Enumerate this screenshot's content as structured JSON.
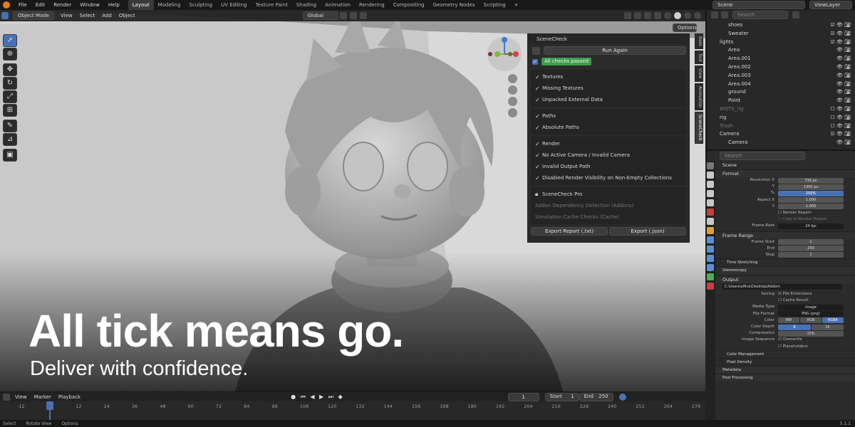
{
  "topbar": {
    "menus": [
      "File",
      "Edit",
      "Render",
      "Window",
      "Help"
    ],
    "workspaces": [
      "Layout",
      "Modeling",
      "Sculpting",
      "UV Editing",
      "Texture Paint",
      "Shading",
      "Animation",
      "Rendering",
      "Compositing",
      "Geometry Nodes",
      "Scripting"
    ],
    "add_tab": "+",
    "scene_label": "Scene",
    "view_layer_label": "ViewLayer"
  },
  "viewport_header": {
    "mode": "Object Mode",
    "menus": [
      "View",
      "Select",
      "Add",
      "Object"
    ],
    "transform": "Global",
    "options": "Options"
  },
  "scenecheck": {
    "title": "SceneCheck",
    "run_again": "Run Again",
    "status": "All checks passed",
    "groups": [
      {
        "items": [
          "Textures",
          "Missing Textures",
          "Unpacked External Data"
        ]
      },
      {
        "items": [
          "Paths",
          "Absolute Paths"
        ]
      },
      {
        "items": [
          "Render",
          "No Active Camera / Invalid Camera",
          "Invalid Output Path",
          "Disabled Render Visibility on Non-Empty Collections"
        ]
      }
    ],
    "pro_label": "SceneCheck Pro",
    "pro_items": [
      "Addon Dependency Detection (Addons)",
      "Simulation Cache Checks (Cache)"
    ],
    "export_txt": "Export Report (.txt)",
    "export_json": "Export (.json)"
  },
  "side_tabs": [
    "Item",
    "Tool",
    "View",
    "Animation",
    "SceneCheck"
  ],
  "overlay": {
    "headline": "All tick means go.",
    "subline": "Deliver with confidence."
  },
  "outliner": {
    "search_placeholder": "Search",
    "rows": [
      "shoes",
      "Sweater",
      "lights",
      "Area",
      "Area.001",
      "Area.002",
      "Area.003",
      "Area.004",
      "ground",
      "Point",
      "WGTS_rig",
      "rig",
      "Trash",
      "Camera",
      "Camera"
    ]
  },
  "properties": {
    "search_placeholder": "Search",
    "breadcrumb": "Scene",
    "format_section": "Format",
    "resolution_x_label": "Resolution X",
    "resolution_x": "736 px",
    "y_label": "Y",
    "resolution_y": "1305 px",
    "pct_label": "%",
    "resolution_pct": "200%",
    "aspect_x_label": "Aspect X",
    "aspect_x": "1.000",
    "aspect_y": "1.000",
    "render_region": "Render Region",
    "crop_region": "Crop to Render Region",
    "frame_rate_label": "Frame Rate",
    "frame_rate": "24 fps",
    "frame_range_section": "Frame Range",
    "frame_start_label": "Frame Start",
    "frame_start": "1",
    "end_label": "End",
    "frame_end": "250",
    "step_label": "Step",
    "frame_step": "1",
    "time_stretching": "Time Stretching",
    "stereoscopy": "Stereoscopy",
    "output_section": "Output",
    "output_path": "C:\\Users\\office\\Desktop\\Addon\\",
    "saving_label": "Saving",
    "file_extensions": "File Extensions",
    "cache_result": "Cache Result",
    "media_type_label": "Media Type",
    "media_type": "Image",
    "file_format_label": "File Format",
    "file_format": "PNG (png)",
    "color_label": "Color",
    "color_bw": "BW",
    "color_rgb": "RGB",
    "color_rgba": "RGBA",
    "color_depth_label": "Color Depth",
    "depth_8": "8",
    "depth_16": "16",
    "compression_label": "Compression",
    "compression": "15%",
    "image_sequence_label": "Image Sequence",
    "overwrite": "Overwrite",
    "placeholders": "Placeholders",
    "color_management": "Color Management",
    "pixel_density": "Pixel Density",
    "metadata": "Metadata",
    "post_processing": "Post Processing"
  },
  "timeline": {
    "menus": [
      "View",
      "Marker",
      "Playback"
    ],
    "current_frame": "1",
    "start_label": "Start",
    "start": "1",
    "end_label": "End",
    "end": "250",
    "ticks": [
      "-12",
      "1",
      "12",
      "24",
      "36",
      "48",
      "60",
      "72",
      "84",
      "96",
      "108",
      "120",
      "132",
      "144",
      "156",
      "168",
      "180",
      "192",
      "204",
      "216",
      "228",
      "240",
      "252",
      "264",
      "276"
    ]
  },
  "statusbar": {
    "select": "Select",
    "rotate_view": "Rotate View",
    "options": "Options",
    "version": "5.1.1"
  }
}
